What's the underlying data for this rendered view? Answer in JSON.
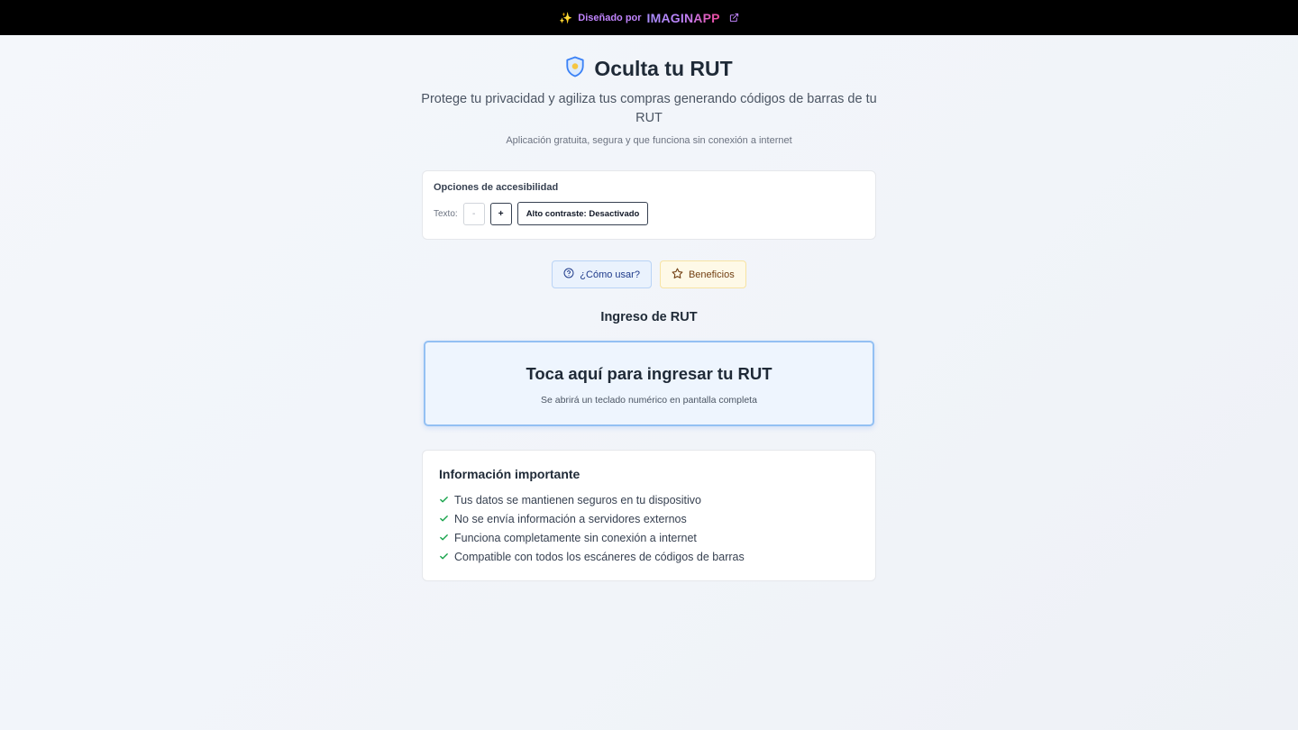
{
  "banner": {
    "sparkle": "✨",
    "designed_by": "Diseñado por",
    "brand": "IMAGINAPP",
    "brand_colors": [
      "#a78bfa",
      "#ec4899"
    ]
  },
  "header": {
    "title": "Oculta tu RUT",
    "subtitle": "Protege tu privacidad y agiliza tus compras generando códigos de barras de tu RUT",
    "tagline": "Aplicación gratuita, segura y que funciona sin conexión a internet"
  },
  "accessibility": {
    "title": "Opciones de accesibilidad",
    "text_label": "Texto:",
    "decrease_label": "-",
    "increase_label": "+",
    "contrast_label": "Alto contraste: Desactivado"
  },
  "actions": {
    "help_label": "¿Cómo usar?",
    "benefits_label": "Beneficios"
  },
  "rut_section": {
    "title": "Ingreso de RUT",
    "card_title": "Toca aquí para ingresar tu RUT",
    "card_subtitle": "Se abrirá un teclado numérico en pantalla completa"
  },
  "info": {
    "title": "Información importante",
    "items": [
      "Tus datos se mantienen seguros en tu dispositivo",
      "No se envía información a servidores externos",
      "Funciona completamente sin conexión a internet",
      "Compatible con todos los escáneres de códigos de barras"
    ]
  },
  "colors": {
    "accent_blue": "#3b82f6",
    "check_green": "#16a34a",
    "banner_bg": "#000000"
  }
}
